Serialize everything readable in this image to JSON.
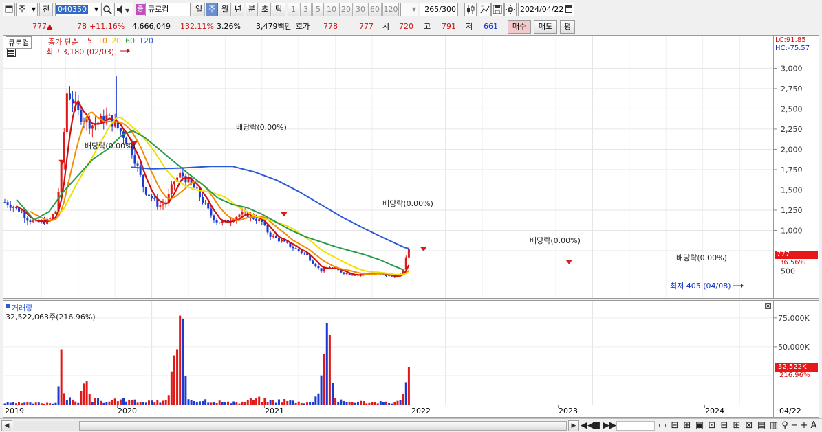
{
  "toolbar": {
    "period_label": "주",
    "prev_label": "전",
    "code_value": "040350",
    "stock_name": "큐로컴",
    "stock_badge": "종",
    "buttons": [
      {
        "label": "일",
        "active": false
      },
      {
        "label": "주",
        "active": true
      },
      {
        "label": "월",
        "active": false
      },
      {
        "label": "년",
        "active": false
      },
      {
        "label": "분",
        "active": false
      },
      {
        "label": "초",
        "active": false
      },
      {
        "label": "틱",
        "active": false
      }
    ],
    "intervals": [
      "1",
      "3",
      "5",
      "10",
      "20",
      "30",
      "60",
      "120"
    ],
    "count_value": "265",
    "count_total": "/300",
    "date_value": "2024/04/22"
  },
  "infobar": {
    "price": "777",
    "arrow": "▲",
    "change": "78",
    "change_pct": "+11.16%",
    "volume": "4,666,049",
    "volume_ratio": "132.11%",
    "turnover": "3.26%",
    "amount": "3,479백만",
    "hoga_label": "호가",
    "hoga_ask": "778",
    "hoga_bid": "777",
    "open_label": "시",
    "open": "720",
    "high_label": "고",
    "high": "791",
    "low_label": "저",
    "low": "661",
    "buy_label": "매수",
    "sell_label": "매도",
    "eval_label": "평"
  },
  "price_pane": {
    "stock_label": "큐로컴",
    "ma_title": "종가 단순",
    "ma_periods": [
      "5",
      "10",
      "20",
      "60",
      "120"
    ],
    "ma_colors": [
      "#d01010",
      "#f08c00",
      "#f0e000",
      "#2a9a4a",
      "#2a5ad8"
    ],
    "high_note": "최고 3,180 (02/03)",
    "low_note": "최저 405 (04/08)",
    "lc": "LC:91.85",
    "hc": "HC:-75.57",
    "current_price": "777",
    "current_pct": "36.56%",
    "dividend_notes": [
      "배당락(0.00%)",
      "배당락(0.00%)",
      "배당락(0.00%)",
      "배당락(0.00%)",
      "배당락(0.00%)"
    ]
  },
  "volume_pane": {
    "title": "거래량",
    "summary": "32,522,063주(216.96%)",
    "current": "32,522K",
    "current_pct": "216.96%"
  },
  "date_axis": {
    "labels": [
      "2019",
      "2020",
      "2021",
      "2022",
      "2023",
      "2024"
    ],
    "current_date": "04/22"
  },
  "chart_data": {
    "type": "candlestick",
    "title": "큐로컴 주봉",
    "ylim": [
      250,
      3300
    ],
    "yticks": [
      500,
      750,
      1000,
      1250,
      1500,
      1750,
      2000,
      2250,
      2500,
      2750,
      3000
    ],
    "ytick_labels": [
      "500",
      "1,000",
      "1,250",
      "1,500",
      "1,750",
      "2,000",
      "2,250",
      "2,500",
      "2,750",
      "3,000"
    ],
    "volume_ylim": [
      0,
      85000
    ],
    "volume_ticks": [
      25000,
      50000,
      75000
    ],
    "volume_tick_labels": [
      "50,000K",
      "75,000K"
    ],
    "close_series": [
      [
        0.0,
        1350
      ],
      [
        0.05,
        1300
      ],
      [
        0.1,
        1250
      ],
      [
        0.15,
        1150
      ],
      [
        0.2,
        1100
      ],
      [
        0.25,
        1100
      ],
      [
        0.3,
        1120
      ],
      [
        0.35,
        1250
      ],
      [
        0.38,
        1700
      ],
      [
        0.4,
        2100
      ],
      [
        0.42,
        2700
      ],
      [
        0.45,
        2650
      ],
      [
        0.5,
        2450
      ],
      [
        0.55,
        2350
      ],
      [
        0.6,
        2300
      ],
      [
        0.65,
        2350
      ],
      [
        0.7,
        2400
      ],
      [
        0.75,
        2300
      ],
      [
        0.8,
        2200
      ],
      [
        0.85,
        2050
      ],
      [
        0.9,
        1800
      ],
      [
        0.95,
        1500
      ],
      [
        1.0,
        1400
      ],
      [
        1.05,
        1300
      ],
      [
        1.1,
        1350
      ],
      [
        1.15,
        1600
      ],
      [
        1.2,
        1700
      ],
      [
        1.25,
        1600
      ],
      [
        1.3,
        1500
      ],
      [
        1.35,
        1350
      ],
      [
        1.4,
        1200
      ],
      [
        1.45,
        1100
      ],
      [
        1.5,
        1100
      ],
      [
        1.55,
        1150
      ],
      [
        1.6,
        1200
      ],
      [
        1.65,
        1200
      ],
      [
        1.7,
        1150
      ],
      [
        1.75,
        1100
      ],
      [
        1.8,
        950
      ],
      [
        1.85,
        900
      ],
      [
        1.9,
        850
      ],
      [
        1.95,
        800
      ],
      [
        2.0,
        750
      ],
      [
        2.05,
        700
      ],
      [
        2.1,
        600
      ],
      [
        2.15,
        500
      ],
      [
        2.2,
        550
      ],
      [
        2.25,
        520
      ],
      [
        2.3,
        480
      ],
      [
        2.35,
        460
      ],
      [
        2.4,
        450
      ],
      [
        2.45,
        470
      ],
      [
        2.5,
        480
      ],
      [
        2.55,
        460
      ],
      [
        2.6,
        440
      ],
      [
        2.65,
        430
      ],
      [
        2.7,
        450
      ],
      [
        2.75,
        777
      ]
    ],
    "ma60_series": [
      [
        0.08,
        1380
      ],
      [
        0.2,
        1130
      ],
      [
        0.3,
        1230
      ],
      [
        0.4,
        1480
      ],
      [
        0.5,
        1680
      ],
      [
        0.6,
        1880
      ],
      [
        0.7,
        2000
      ],
      [
        0.8,
        2180
      ],
      [
        0.87,
        2230
      ],
      [
        0.95,
        2150
      ],
      [
        1.05,
        2000
      ],
      [
        1.15,
        1850
      ],
      [
        1.25,
        1700
      ],
      [
        1.35,
        1560
      ],
      [
        1.45,
        1400
      ],
      [
        1.55,
        1320
      ],
      [
        1.65,
        1280
      ],
      [
        1.75,
        1200
      ],
      [
        1.85,
        1100
      ],
      [
        1.95,
        1000
      ],
      [
        2.05,
        920
      ],
      [
        2.15,
        860
      ],
      [
        2.25,
        800
      ],
      [
        2.35,
        750
      ],
      [
        2.45,
        700
      ],
      [
        2.55,
        640
      ],
      [
        2.65,
        560
      ],
      [
        2.72,
        510
      ]
    ],
    "ma120_series": [
      [
        0.86,
        1780
      ],
      [
        1.0,
        1760
      ],
      [
        1.2,
        1770
      ],
      [
        1.4,
        1790
      ],
      [
        1.55,
        1790
      ],
      [
        1.7,
        1720
      ],
      [
        1.85,
        1620
      ],
      [
        2.0,
        1480
      ],
      [
        2.15,
        1320
      ],
      [
        2.3,
        1160
      ],
      [
        2.45,
        1020
      ],
      [
        2.6,
        890
      ],
      [
        2.72,
        790
      ],
      [
        2.75,
        777
      ]
    ],
    "volume_series": [
      [
        0.0,
        1500
      ],
      [
        0.1,
        1800
      ],
      [
        0.2,
        1500
      ],
      [
        0.3,
        2000
      ],
      [
        0.36,
        2500
      ],
      [
        0.38,
        76000
      ],
      [
        0.39,
        15000
      ],
      [
        0.4,
        9000
      ],
      [
        0.42,
        8000
      ],
      [
        0.45,
        5000
      ],
      [
        0.5,
        4000
      ],
      [
        0.52,
        12000
      ],
      [
        0.55,
        25000
      ],
      [
        0.58,
        6000
      ],
      [
        0.7,
        3000
      ],
      [
        0.75,
        6000
      ],
      [
        0.8,
        5000
      ],
      [
        0.9,
        4000
      ],
      [
        1.0,
        3000
      ],
      [
        1.1,
        4000
      ],
      [
        1.2,
        83000
      ],
      [
        1.25,
        8000
      ],
      [
        1.3,
        6000
      ],
      [
        1.4,
        5000
      ],
      [
        1.5,
        2500
      ],
      [
        1.6,
        2000
      ],
      [
        1.7,
        7000
      ],
      [
        1.8,
        4000
      ],
      [
        1.9,
        5000
      ],
      [
        2.0,
        3000
      ],
      [
        2.1,
        2500
      ],
      [
        2.2,
        76000
      ],
      [
        2.25,
        7000
      ],
      [
        2.3,
        3000
      ],
      [
        2.4,
        3500
      ],
      [
        2.5,
        2500
      ],
      [
        2.6,
        2500
      ],
      [
        2.65,
        2000
      ],
      [
        2.7,
        5000
      ],
      [
        2.72,
        12000
      ],
      [
        2.75,
        32522
      ]
    ],
    "x_start_year": 2019,
    "x_end": "2024/04/22"
  }
}
